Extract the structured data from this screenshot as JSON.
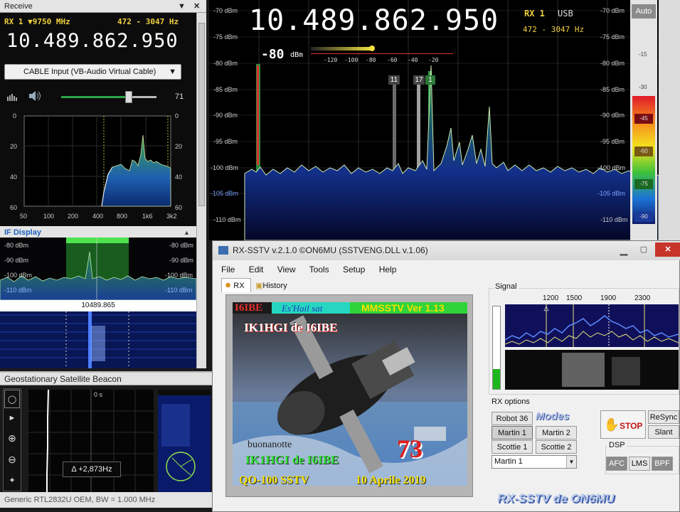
{
  "receive": {
    "title": "Receive",
    "rx_line": "RX 1 ▼9750 MHz",
    "band": "472 - 3047 Hz",
    "frequency": "10.489.862.950",
    "audio_device": "CABLE Input (VB-Audio Virtual Cable)",
    "volume": "71",
    "volume_level": 0.71,
    "audio_y_ticks": [
      "0",
      "20",
      "40",
      "60"
    ],
    "audio_x_ticks": [
      "50",
      "100",
      "200",
      "400",
      "800",
      "1k6",
      "3k2"
    ]
  },
  "if_display": {
    "title": "IF Display",
    "levels": [
      "-80 dBm",
      "-90 dBm",
      "-100 dBm",
      "-110 dBm"
    ],
    "freq": "10489.865"
  },
  "beacon": {
    "title": "Geostationary Satellite Beacon",
    "time": "0 s",
    "delta": "Δ +2,873Hz",
    "status": "Generic RTL2832U OEM, BW = 1.000 MHz"
  },
  "spectrum": {
    "frequency": "10.489.862.950",
    "rx": "RX 1",
    "mode": "USB",
    "band": "472 - 3047 Hz",
    "smeter_value": "-80",
    "smeter_unit": "dBm",
    "smeter_ticks": [
      "-120",
      "-100",
      "-80",
      "-60",
      "-40",
      "-20"
    ],
    "markers": [
      "11",
      "17",
      "1"
    ],
    "levels": [
      "-70 dBm",
      "-75 dBm",
      "-80 dBm",
      "-85 dBm",
      "-90 dBm",
      "-95 dBm",
      "-100 dBm",
      "-105 dBm",
      "-110 dBm"
    ],
    "auto_label": "Auto",
    "scale_ticks": [
      "-15",
      "-30",
      "-45",
      "-60",
      "-75",
      "-90"
    ]
  },
  "sstv": {
    "title": "RX-SSTV v.2.1.0 ©ON6MU (SSTVENG.DLL v.1.06)",
    "menu": [
      "File",
      "Edit",
      "View",
      "Tools",
      "Setup",
      "Help"
    ],
    "tabs": [
      "RX",
      "History"
    ],
    "image_text": {
      "callsign": "I6IBE",
      "de_line": "IK1HGI de I6IBE",
      "header": "MMSSTV Ver 1.13",
      "qo": "QO-100 SSTV",
      "date": "10 Aprile 2019",
      "seventy_three": "73",
      "bottom_line": "IK1HGI de I6IBE",
      "mid": "buonanotte",
      "top_green": "Es'Hail sat"
    },
    "signal_label": "Signal",
    "signal_ticks": [
      "1200",
      "1500",
      "1900",
      "2300"
    ],
    "rx_options_label": "RX options",
    "modes_logo": "Modes",
    "mode_buttons": [
      "Robot 36",
      "Martin 1",
      "Martin 2",
      "Scottie 1",
      "Scottie 2"
    ],
    "selected_mode": "Martin 1",
    "stop_label": "STOP",
    "resync_label": "ReSync",
    "slant_label": "Slant",
    "dsp_label": "DSP",
    "dsp_buttons": [
      "AFC",
      "LMS",
      "BPF"
    ],
    "logo_text": "RX-SSTV de ON6MU"
  }
}
